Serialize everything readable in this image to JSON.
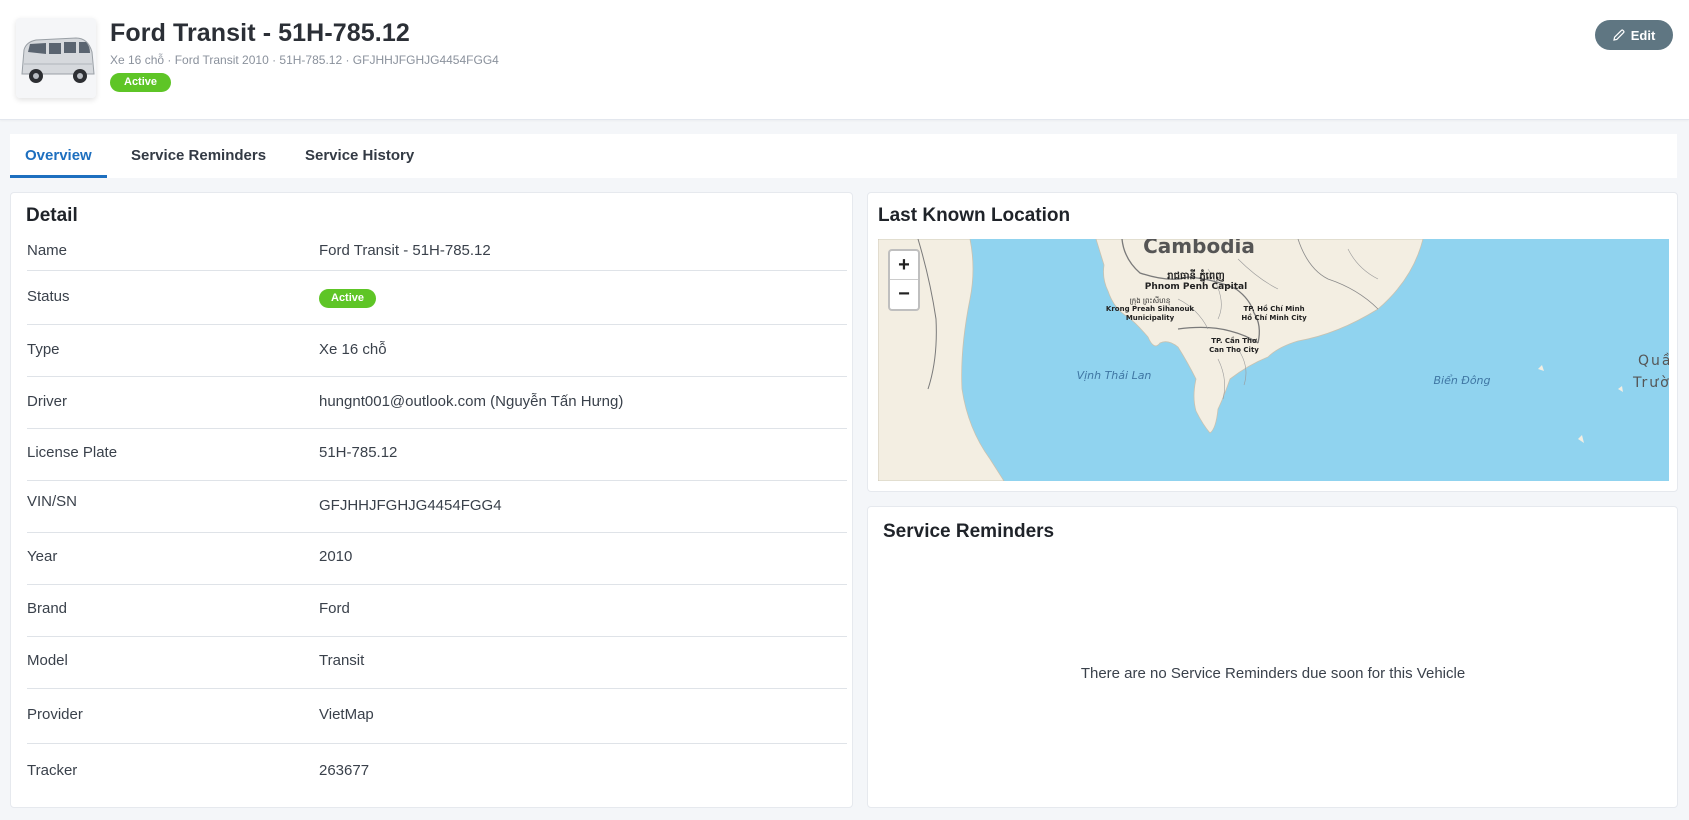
{
  "header": {
    "title": "Ford Transit - 51H-785.12",
    "subtitle": "Xe 16 chỗ · Ford Transit 2010 · 51H-785.12 · GFJHHJFGHJG4454FGG4",
    "status": "Active",
    "edit_label": "Edit",
    "edit_icon": "pencil-icon"
  },
  "tabs": [
    {
      "label": "Overview",
      "active": true
    },
    {
      "label": "Service Reminders",
      "active": false
    },
    {
      "label": "Service History",
      "active": false
    }
  ],
  "detail": {
    "title": "Detail",
    "rows": [
      {
        "label": "Name",
        "value": "Ford Transit - 51H-785.12"
      },
      {
        "label": "Status",
        "value": "Active"
      },
      {
        "label": "Type",
        "value": "Xe 16 chỗ"
      },
      {
        "label": "Driver",
        "value": "hungnt001@outlook.com (Nguyễn Tấn Hưng)"
      },
      {
        "label": "License Plate",
        "value": "51H-785.12"
      },
      {
        "label": "VIN/SN",
        "value": "GFJHHJFGHJG4454FGG4"
      },
      {
        "label": "Year",
        "value": "2010"
      },
      {
        "label": "Brand",
        "value": "Ford"
      },
      {
        "label": "Model",
        "value": "Transit"
      },
      {
        "label": "Provider",
        "value": "VietMap"
      },
      {
        "label": "Tracker",
        "value": "263677"
      }
    ]
  },
  "location": {
    "title": "Last Known Location",
    "zoom_in": "+",
    "zoom_out": "−",
    "map_labels": {
      "country": "Cambodia",
      "capital_khmer": "រាជធានី ភ្នំពេញ",
      "capital": "Phnom Penh Capital",
      "sihanouk_khmer": "ក្រុង ព្រះសីហនុ",
      "sihanouk_1": "Krong Preah Sihanouk",
      "sihanouk_2": "Municipality",
      "hcm_1": "TP. Hồ Chí Minh",
      "hcm_2": "Hồ Chí Minh City",
      "cantho_1": "TP. Cần Thơ",
      "cantho_2": "Can Tho City",
      "gulf": "Vịnh Thái Lan",
      "east_sea": "Biển Đông",
      "islands_1": "Quần",
      "islands_2": "Trườn"
    },
    "colors": {
      "water": "#90d3ef",
      "land": "#f3eee2",
      "border": "#7a7a7a"
    }
  },
  "reminders": {
    "title": "Service Reminders",
    "empty_message": "There are no Service Reminders due soon for this Vehicle"
  }
}
